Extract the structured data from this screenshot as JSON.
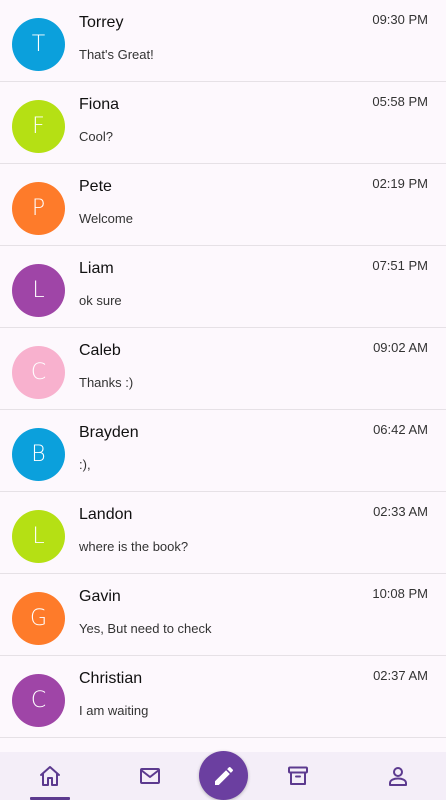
{
  "conversations": [
    {
      "initial": "T",
      "name": "Torrey",
      "message": "That's Great!",
      "time": "09:30 PM",
      "color": "#0ba0dc"
    },
    {
      "initial": "F",
      "name": "Fiona",
      "message": "Cool?",
      "time": "05:58 PM",
      "color": "#b5e014"
    },
    {
      "initial": "P",
      "name": "Pete",
      "message": "Welcome",
      "time": "02:19 PM",
      "color": "#fe7b2a"
    },
    {
      "initial": "L",
      "name": "Liam",
      "message": "ok sure",
      "time": "07:51 PM",
      "color": "#9f45a7"
    },
    {
      "initial": "C",
      "name": "Caleb",
      "message": "Thanks :)",
      "time": "09:02 AM",
      "color": "#f8b1ce"
    },
    {
      "initial": "B",
      "name": "Brayden",
      "message": ":),",
      "time": "06:42 AM",
      "color": "#0ba0dc"
    },
    {
      "initial": "L",
      "name": "Landon",
      "message": "where is the book?",
      "time": "02:33 AM",
      "color": "#b5e014"
    },
    {
      "initial": "G",
      "name": "Gavin",
      "message": "Yes, But need to check",
      "time": "10:08 PM",
      "color": "#fe7b2a"
    },
    {
      "initial": "C",
      "name": "Christian",
      "message": "I am waiting",
      "time": "02:37 AM",
      "color": "#9f45a7"
    }
  ],
  "nav": {
    "items": [
      {
        "icon": "home-icon",
        "active": true
      },
      {
        "icon": "mail-icon",
        "active": false
      },
      {
        "icon": "compose-icon",
        "active": false
      },
      {
        "icon": "archive-icon",
        "active": false
      },
      {
        "icon": "profile-icon",
        "active": false
      }
    ],
    "accent_color": "#5c3a8f",
    "fab_color": "#6b3fa0"
  }
}
